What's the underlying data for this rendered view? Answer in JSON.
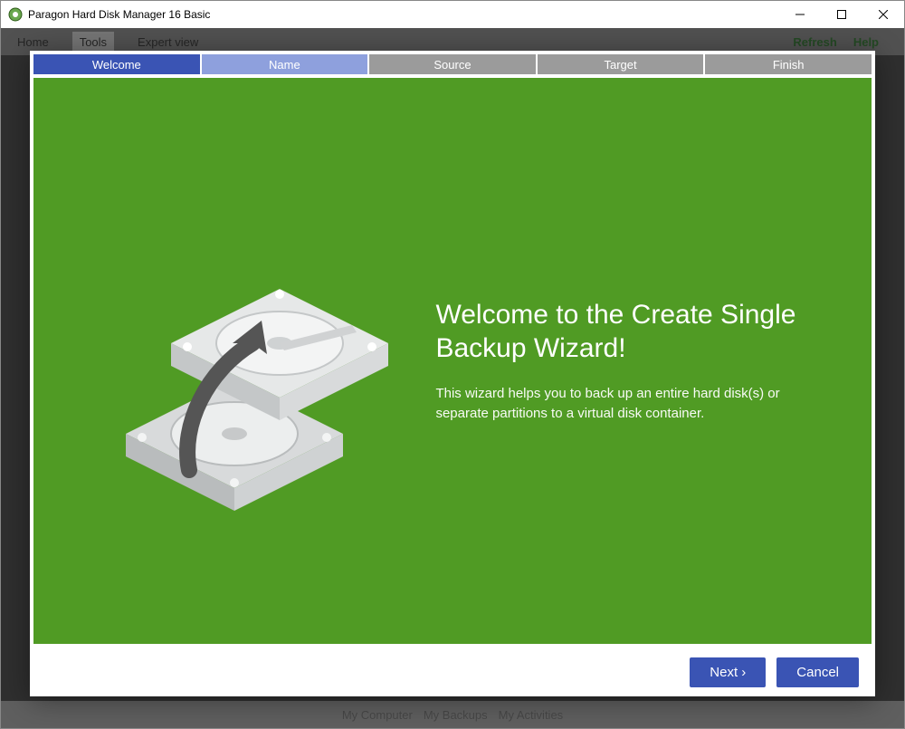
{
  "window": {
    "title": "Paragon Hard Disk Manager 16 Basic"
  },
  "bg_toolbar": {
    "home": "Home",
    "tools": "Tools",
    "expert": "Expert view",
    "refresh": "Refresh",
    "help": "Help"
  },
  "bg_bottom": {
    "a": "My Computer",
    "b": "My Backups",
    "c": "My Activities"
  },
  "wizard": {
    "steps": {
      "s1": "Welcome",
      "s2": "Name",
      "s3": "Source",
      "s4": "Target",
      "s5": "Finish"
    },
    "heading": "Welcome to the Create Single Backup Wizard!",
    "desc": "This wizard helps you to back up an entire hard disk(s) or separate partitions to a virtual disk container.",
    "next": "Next ›",
    "cancel": "Cancel"
  }
}
